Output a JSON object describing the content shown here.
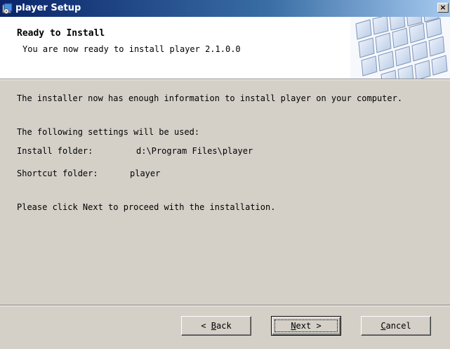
{
  "window": {
    "title": "player Setup",
    "close_glyph": "×",
    "icon": "setup-icon"
  },
  "banner": {
    "heading": "Ready to Install",
    "subheading": "You are now ready to install player 2.1.0.0",
    "art": "keyboard-art"
  },
  "body": {
    "intro": "The installer now has enough information to install player on your computer.",
    "settings_intro": "The following settings will be used:",
    "install_folder_label": "Install folder:",
    "install_folder_value": "d:\\Program Files\\player",
    "shortcut_folder_label": "Shortcut folder:",
    "shortcut_folder_value": "player",
    "instruction": "Please click Next to proceed with the installation."
  },
  "buttons": {
    "back": {
      "prefix": "< ",
      "accel": "B",
      "rest": "ack"
    },
    "next": {
      "accel": "N",
      "rest": "ext >"
    },
    "cancel": {
      "accel": "C",
      "rest": "ancel"
    }
  },
  "colors": {
    "titlebar_start": "#0a246a",
    "titlebar_end": "#a6caf0",
    "dialog_face": "#d4d0c8"
  }
}
